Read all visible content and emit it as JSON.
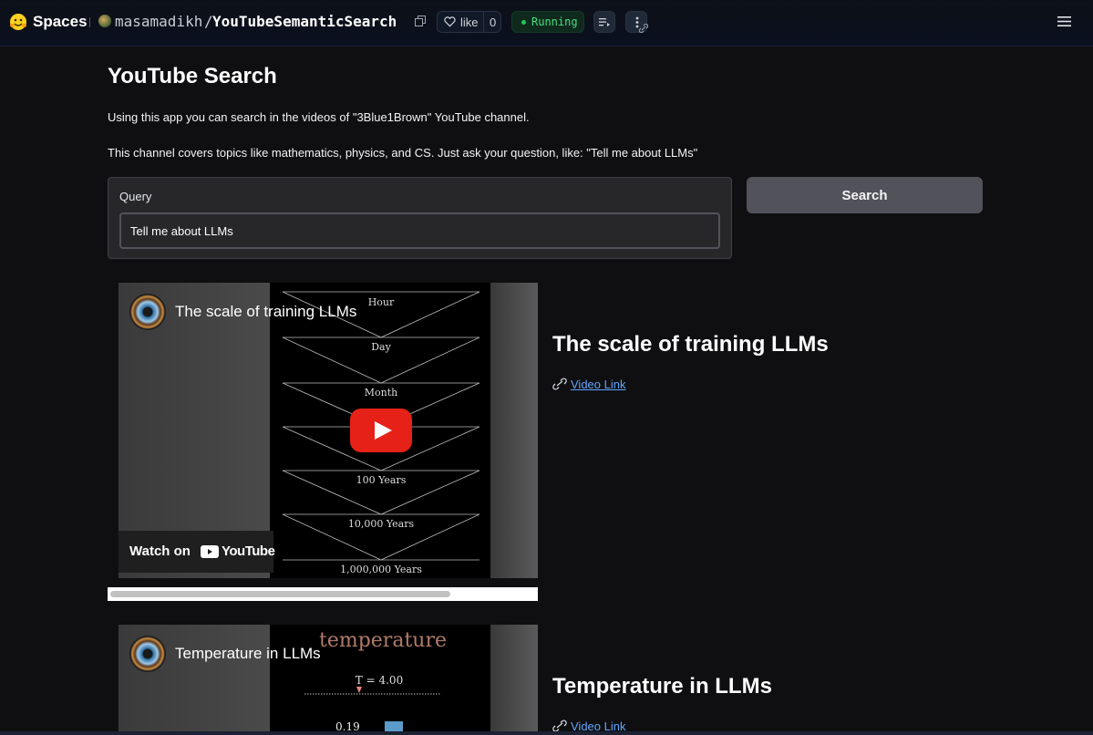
{
  "header": {
    "spaces_label": "Spaces",
    "owner": "masamadikh",
    "separator": "/",
    "repo": "YouTubeSemanticSearch",
    "like_label": "like",
    "like_count": "0",
    "status": "Running",
    "status_color": "#22c55e"
  },
  "main": {
    "title": "YouTube Search",
    "description_1": "Using this app you can search in the videos of \"3Blue1Brown\" YouTube channel.",
    "description_2": "This channel covers topics like mathematics, physics, and CS. Just ask your question, like: \"Tell me about LLMs\"",
    "query_label": "Query",
    "query_value": "Tell me about LLMs",
    "search_button": "Search"
  },
  "results": [
    {
      "title": "The scale of training LLMs",
      "video_title": "The scale of training LLMs",
      "link_label": "Video Link",
      "frame_labels": [
        "Hour",
        "Day",
        "Month",
        "100 Years",
        "10,000 Years",
        "1,000,000 Years"
      ],
      "watch_on": "Watch on",
      "youtube_word": "YouTube"
    },
    {
      "title": "Temperature in LLMs",
      "video_title": "Temperature in LLMs",
      "link_label": "Video Link",
      "frame_heading": "temperature",
      "frame_formula": "T = 4.00",
      "frame_value": "0.19"
    }
  ],
  "colors": {
    "accent_link": "#60a5fa",
    "youtube_red": "#e62117",
    "button_bg": "#52525b"
  }
}
